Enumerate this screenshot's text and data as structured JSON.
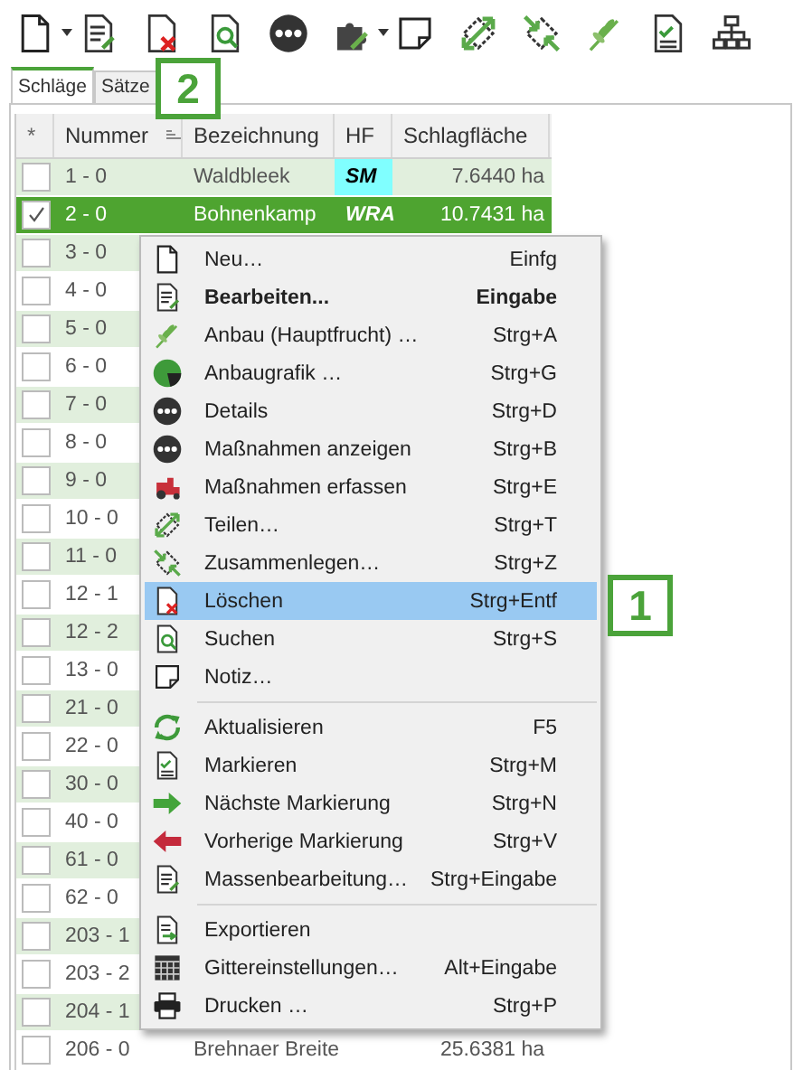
{
  "tabs": [
    {
      "label": "Schläge",
      "selected": true
    },
    {
      "label": "Sätze",
      "selected": false
    }
  ],
  "table": {
    "columns": [
      "*",
      "Nummer",
      "Bezeichnung",
      "HF",
      "Schlagfläche"
    ],
    "rows": [
      {
        "nummer": "1 - 0",
        "bezeichnung": "Waldbleek",
        "hf": {
          "label": "SM",
          "color": "#80ffff"
        },
        "flaeche": "7.6440 ha",
        "checked": false,
        "selected": false
      },
      {
        "nummer": "2 - 0",
        "bezeichnung": "Bohnenkamp",
        "hf": {
          "label": "WRA"
        },
        "flaeche": "10.7431 ha",
        "checked": true,
        "selected": true
      },
      {
        "nummer": "3 - 0",
        "checked": false,
        "selected": false
      },
      {
        "nummer": "4 - 0",
        "checked": false,
        "selected": false
      },
      {
        "nummer": "5 - 0",
        "checked": false,
        "selected": false
      },
      {
        "nummer": "6 - 0",
        "checked": false,
        "selected": false
      },
      {
        "nummer": "7 - 0",
        "checked": false,
        "selected": false
      },
      {
        "nummer": "8 - 0",
        "checked": false,
        "selected": false
      },
      {
        "nummer": "9 - 0",
        "checked": false,
        "selected": false
      },
      {
        "nummer": "10 - 0",
        "checked": false,
        "selected": false
      },
      {
        "nummer": "11 - 0",
        "checked": false,
        "selected": false
      },
      {
        "nummer": "12 - 1",
        "checked": false,
        "selected": false
      },
      {
        "nummer": "12 - 2",
        "checked": false,
        "selected": false
      },
      {
        "nummer": "13 - 0",
        "checked": false,
        "selected": false
      },
      {
        "nummer": "21 - 0",
        "checked": false,
        "selected": false
      },
      {
        "nummer": "22 - 0",
        "checked": false,
        "selected": false
      },
      {
        "nummer": "30 - 0",
        "checked": false,
        "selected": false
      },
      {
        "nummer": "40 - 0",
        "checked": false,
        "selected": false
      },
      {
        "nummer": "61 - 0",
        "checked": false,
        "selected": false
      },
      {
        "nummer": "62 - 0",
        "checked": false,
        "selected": false
      },
      {
        "nummer": "203 - 1",
        "checked": false,
        "selected": false
      },
      {
        "nummer": "203 - 2",
        "checked": false,
        "selected": false
      },
      {
        "nummer": "204 - 1",
        "checked": false,
        "selected": false
      },
      {
        "nummer": "206 - 0",
        "bezeichnung": "Brehnaer Breite",
        "flaeche": "25.6381 ha",
        "checked": false,
        "selected": false
      }
    ]
  },
  "context_menu": [
    {
      "kind": "item",
      "label": "Neu…",
      "shortcut": "Einfg",
      "bold": false,
      "selected": false
    },
    {
      "kind": "item",
      "label": "Bearbeiten...",
      "shortcut": "Eingabe",
      "bold": true,
      "selected": false
    },
    {
      "kind": "item",
      "label": "Anbau (Hauptfrucht) …",
      "shortcut": "Strg+A",
      "bold": false,
      "selected": false
    },
    {
      "kind": "item",
      "label": "Anbaugrafik …",
      "shortcut": "Strg+G",
      "bold": false,
      "selected": false
    },
    {
      "kind": "item",
      "label": "Details",
      "shortcut": "Strg+D",
      "bold": false,
      "selected": false
    },
    {
      "kind": "item",
      "label": "Maßnahmen anzeigen",
      "shortcut": "Strg+B",
      "bold": false,
      "selected": false
    },
    {
      "kind": "item",
      "label": "Maßnahmen erfassen",
      "shortcut": "Strg+E",
      "bold": false,
      "selected": false
    },
    {
      "kind": "item",
      "label": "Teilen…",
      "shortcut": "Strg+T",
      "bold": false,
      "selected": false
    },
    {
      "kind": "item",
      "label": "Zusammenlegen…",
      "shortcut": "Strg+Z",
      "bold": false,
      "selected": false
    },
    {
      "kind": "item",
      "label": "Löschen",
      "shortcut": "Strg+Entf",
      "bold": false,
      "selected": true
    },
    {
      "kind": "item",
      "label": "Suchen",
      "shortcut": "Strg+S",
      "bold": false,
      "selected": false
    },
    {
      "kind": "item",
      "label": "Notiz…",
      "bold": false,
      "selected": false
    },
    {
      "kind": "separator"
    },
    {
      "kind": "item",
      "label": "Aktualisieren",
      "shortcut": "F5",
      "bold": false,
      "selected": false
    },
    {
      "kind": "item",
      "label": "Markieren",
      "shortcut": "Strg+M",
      "bold": false,
      "selected": false
    },
    {
      "kind": "item",
      "label": "Nächste Markierung",
      "shortcut": "Strg+N",
      "bold": false,
      "selected": false
    },
    {
      "kind": "item",
      "label": "Vorherige Markierung",
      "shortcut": "Strg+V",
      "bold": false,
      "selected": false
    },
    {
      "kind": "item",
      "label": "Massenbearbeitung…",
      "shortcut": "Strg+Eingabe",
      "bold": false,
      "selected": false
    },
    {
      "kind": "separator"
    },
    {
      "kind": "item",
      "label": "Exportieren",
      "bold": false,
      "selected": false
    },
    {
      "kind": "item",
      "label": "Gittereinstellungen…",
      "shortcut": "Alt+Eingabe",
      "bold": false,
      "selected": false
    },
    {
      "kind": "item",
      "label": "Drucken …",
      "shortcut": "Strg+P",
      "bold": false,
      "selected": false
    }
  ],
  "callouts": [
    {
      "label": "2"
    },
    {
      "label": "1"
    }
  ]
}
